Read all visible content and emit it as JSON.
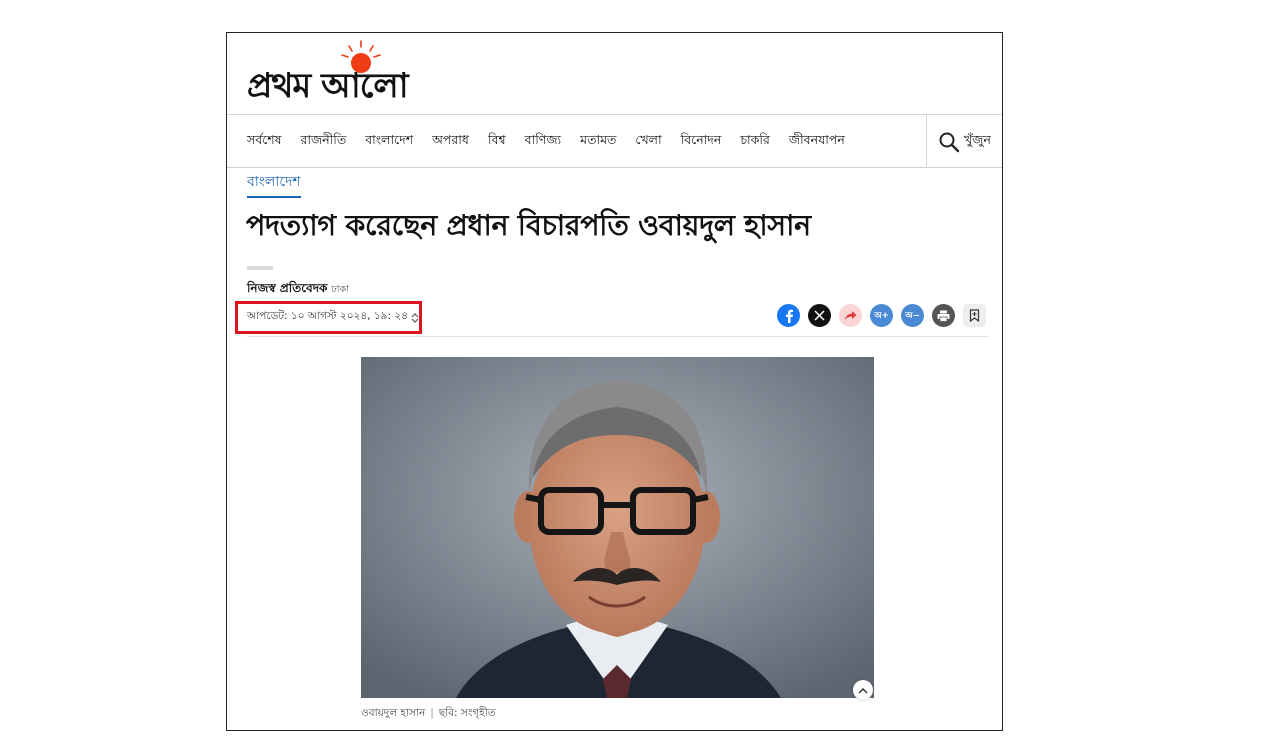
{
  "masthead": {
    "logo_text": "প্রথম আলো"
  },
  "nav": {
    "items": [
      "সর্বশেষ",
      "রাজনীতি",
      "বাংলাদেশ",
      "অপরাধ",
      "বিশ্ব",
      "বাণিজ্য",
      "মতামত",
      "খেলা",
      "বিনোদন",
      "চাকরি",
      "জীবনযাপন"
    ],
    "search_label": "খুঁজুন",
    "search_icon": "search-icon"
  },
  "article": {
    "section": "বাংলাদেশ",
    "headline": "পদত্যাগ করেছেন প্রধান বিচারপতি ওবায়দুল হাসান",
    "author": "নিজস্ব প্রতিবেদক",
    "location": "ঢাকা",
    "updated": "আপডেট: ১০ আগস্ট ২০২৪, ১৯: ২৪",
    "share": {
      "font_up": "অ+",
      "font_down": "অ−"
    },
    "photo": {
      "caption_name": "ওবায়দুল হাসান",
      "caption_credit": "ছবি: সংগৃহীত"
    }
  },
  "colors": {
    "accent": "#1a62b6",
    "highlight_border": "#e0141e",
    "logo_sun": "#f03c14"
  }
}
